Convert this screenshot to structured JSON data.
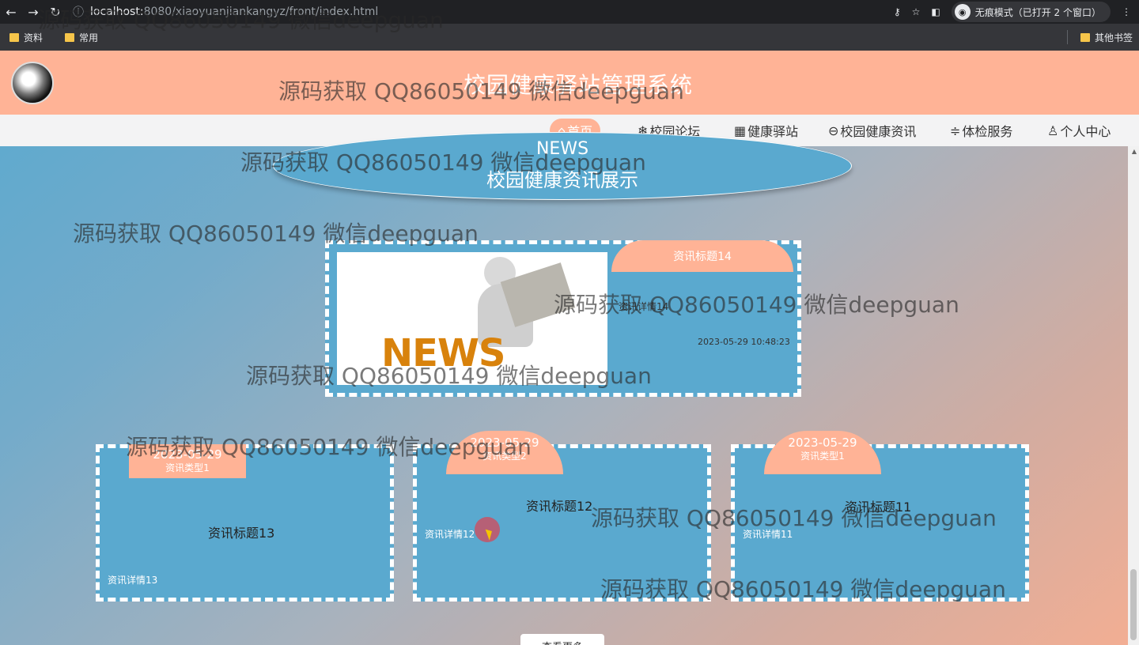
{
  "browser": {
    "back_icon": "←",
    "forward_icon": "→",
    "reload_icon": "↻",
    "url_host": "localhost:",
    "url_rest": "8080/xiaoyuanjiankangyz/front/index.html",
    "incognito_label": "无痕模式（已打开 2 个窗口）",
    "bookmarks": [
      "资料",
      "常用"
    ],
    "other_bookmarks": "其他书签"
  },
  "site": {
    "title": "校园健康驿站管理系统",
    "nav": [
      {
        "icon": "⌂",
        "label": "首页"
      },
      {
        "icon": "❄",
        "label": "校园论坛"
      },
      {
        "icon": "▦",
        "label": "健康驿站"
      },
      {
        "icon": "⊖",
        "label": "校园健康资讯"
      },
      {
        "icon": "≑",
        "label": "体检服务"
      },
      {
        "icon": "♙",
        "label": "个人中心"
      }
    ]
  },
  "news_section": {
    "heading_en": "NEWS",
    "heading_cn": "校园健康资讯展示",
    "featured": {
      "image_word": "NEWS",
      "title": "资讯标题14",
      "detail": "资讯详情14",
      "date": "2023-05-29 10:48:23"
    },
    "cards": [
      {
        "date": "2023-05-29",
        "type": "资讯类型1",
        "title": "资讯标题13",
        "detail": "资讯详情13"
      },
      {
        "date": "2023-05-29",
        "type": "资讯类型2",
        "title": "资讯标题12",
        "detail": "资讯详情12"
      },
      {
        "date": "2023-05-29",
        "type": "资讯类型1",
        "title": "资讯标题11",
        "detail": "资讯详情11"
      }
    ],
    "more_button": "查看更多"
  },
  "watermark": "源码获取 QQ86050149 微信deepguan"
}
